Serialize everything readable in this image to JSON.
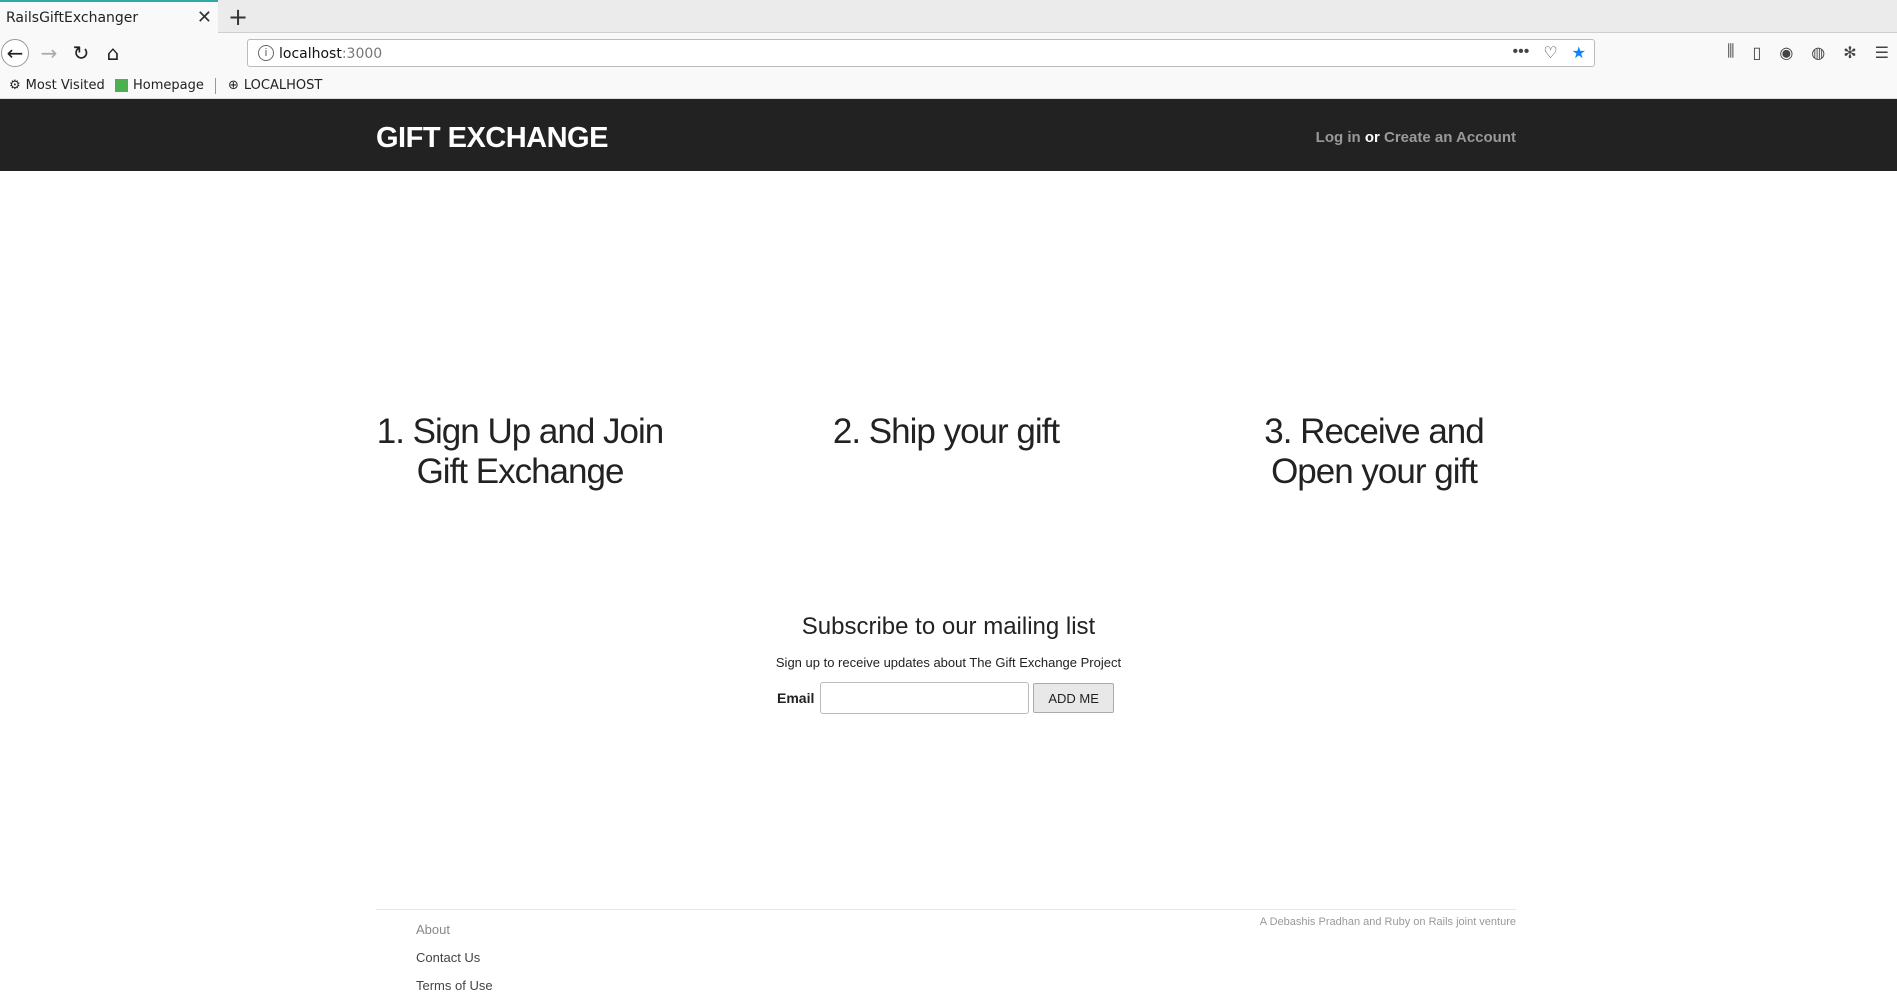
{
  "browser": {
    "tab_title": "RailsGiftExchanger",
    "tab_close": "✕",
    "new_tab": "+",
    "url_host": "localhost",
    "url_port": ":3000",
    "url_more": "•••",
    "bookmarks": [
      "Most Visited",
      "Homepage",
      "LOCALHOST"
    ]
  },
  "header": {
    "logo": "GIFT EXCHANGE",
    "login_label": "Log in",
    "or_label": "or",
    "create_label": "Create an Account"
  },
  "steps": [
    "1. Sign Up and Join Gift Exchange",
    "2. Ship your gift",
    "3. Receive and Open your gift"
  ],
  "subscribe": {
    "title": "Subscribe to our mailing list",
    "text": "Sign up to receive updates about The Gift Exchange Project",
    "email_label": "Email",
    "email_value": "",
    "button_label": "ADD ME"
  },
  "footer": {
    "links": [
      "About",
      "Contact Us",
      "Terms of Use"
    ],
    "credit": "A Debashis Pradhan and Ruby on Rails joint venture"
  }
}
